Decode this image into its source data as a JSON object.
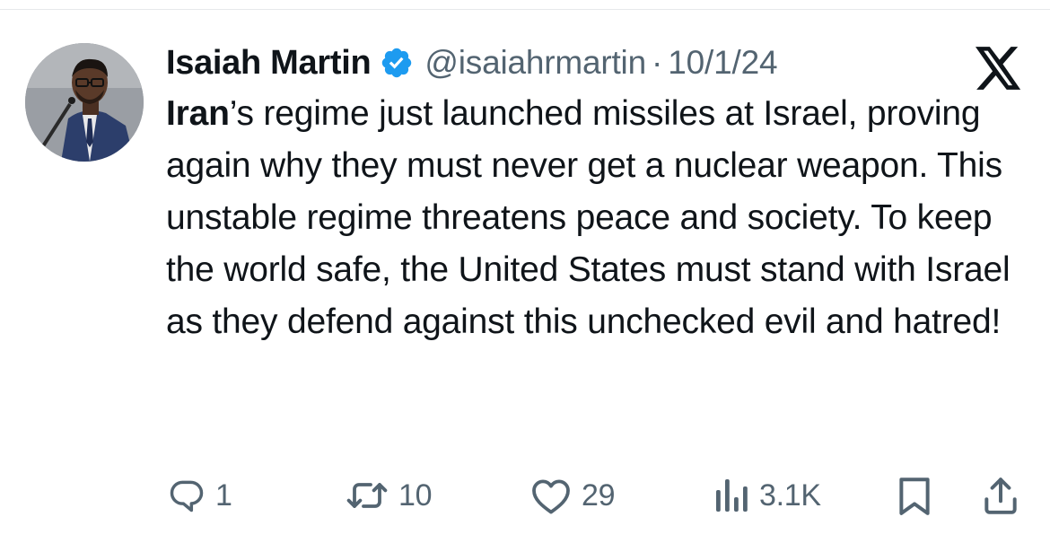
{
  "tweet": {
    "author_name": "Isaiah Martin",
    "verified": true,
    "handle": "@isaiahrmartin",
    "separator": "·",
    "date": "10/1/24",
    "text_bold": "Iran",
    "text_rest": "’s regime just launched missiles at Israel, proving again why they must never get a nuclear weapon. This unstable regime threatens peace and society. To keep the world safe, the United States must stand with Israel as they defend against this unchecked evil and hatred!"
  },
  "actions": {
    "replies": "1",
    "reposts": "10",
    "likes": "29",
    "views": "3.1K"
  },
  "icons": {
    "verified": "verified-badge-icon",
    "platform": "x-logo-icon",
    "reply": "reply-icon",
    "repost": "repost-icon",
    "like": "heart-icon",
    "views": "views-icon",
    "bookmark": "bookmark-icon",
    "share": "share-icon"
  },
  "colors": {
    "text": "#0f1419",
    "secondary": "#536471",
    "verified": "#1d9bf0"
  }
}
